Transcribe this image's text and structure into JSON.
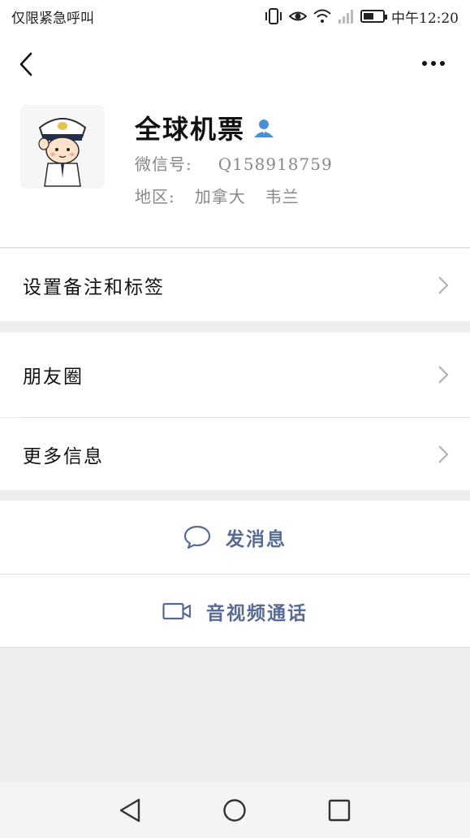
{
  "status_bar": {
    "carrier_text": "仅限紧急呼叫",
    "time": "中午12:20",
    "battery_level": 0.55,
    "icons": [
      "vibrate-icon",
      "eye-comfort-icon",
      "wifi-icon",
      "signal-icon",
      "battery-icon"
    ]
  },
  "nav": {
    "icons": [
      "back-arrow-icon",
      "more-icon"
    ]
  },
  "profile": {
    "name": "全球机票",
    "wechat_label": "微信号:",
    "wechat_id": "Q158918759",
    "region_label": "地区:",
    "region_country": "加拿大",
    "region_city": "韦兰",
    "badge_icon": "person-badge-icon"
  },
  "menu": {
    "remark_tags": "设置备注和标签",
    "moments": "朋友圈",
    "more_info": "更多信息"
  },
  "actions": {
    "send_message": "发消息",
    "video_call": "音视频通话"
  },
  "colors": {
    "link": "#576b95",
    "badge": "#4a90d9",
    "background": "#ededed"
  }
}
